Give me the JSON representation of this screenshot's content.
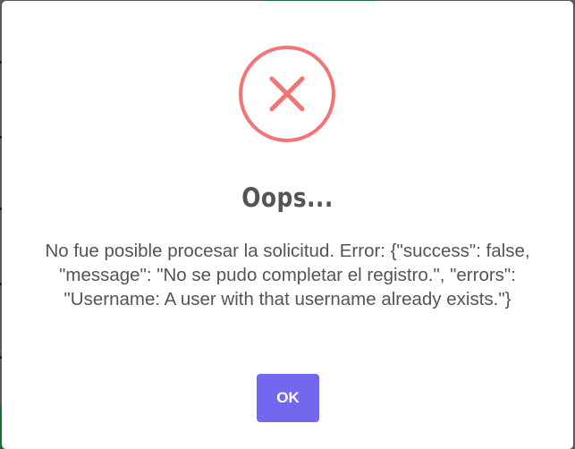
{
  "dialog": {
    "icon": "error-x-icon",
    "title": "Oops...",
    "message": "No fue posible procesar la solicitud. Error: {\"success\": false, \"message\": \"No se pudo completar el registro.\", \"errors\": \"Username: A user with that username already exists.\"}",
    "ok_label": "OK"
  },
  "colors": {
    "error_accent": "#f27474",
    "button_bg": "#7367f0",
    "text": "#545454"
  }
}
